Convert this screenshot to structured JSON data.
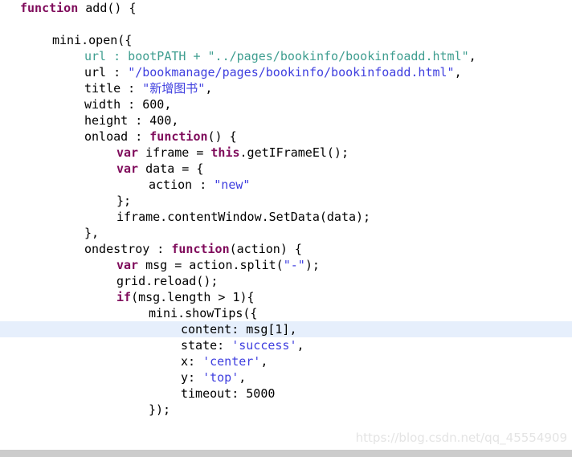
{
  "editor": {
    "language": "javascript",
    "background_color": "#ffffff",
    "highlight_color": "#e6effc",
    "highlighted_line_index": 20,
    "colors": {
      "keyword": "#7f0b5b",
      "string": "#3f3fdf",
      "comment": "#3f9e90",
      "plain": "#000000"
    },
    "lines": [
      {
        "indent": 0,
        "highlighted": false,
        "tokens": [
          {
            "t": "function",
            "c": "kw"
          },
          {
            "t": " add() {",
            "c": "pln"
          }
        ]
      },
      {
        "indent": 0,
        "highlighted": false,
        "tokens": [
          {
            "t": "",
            "c": "pln"
          }
        ]
      },
      {
        "indent": 2,
        "highlighted": false,
        "tokens": [
          {
            "t": "mini.open({",
            "c": "pln"
          }
        ]
      },
      {
        "indent": 4,
        "highlighted": false,
        "tokens": [
          {
            "t": "url : bootPATH + \"../pages/bookinfo/bookinfoadd.html\"",
            "c": "cmt"
          },
          {
            "t": ",",
            "c": "pln"
          }
        ]
      },
      {
        "indent": 4,
        "highlighted": false,
        "tokens": [
          {
            "t": "url : ",
            "c": "pln"
          },
          {
            "t": "\"/bookmanage/pages/bookinfo/bookinfoadd.html\"",
            "c": "str"
          },
          {
            "t": ",",
            "c": "pln"
          }
        ]
      },
      {
        "indent": 4,
        "highlighted": false,
        "tokens": [
          {
            "t": "title : ",
            "c": "pln"
          },
          {
            "t": "\"新增图书\"",
            "c": "str"
          },
          {
            "t": ",",
            "c": "pln"
          }
        ]
      },
      {
        "indent": 4,
        "highlighted": false,
        "tokens": [
          {
            "t": "width : 600,",
            "c": "pln"
          }
        ]
      },
      {
        "indent": 4,
        "highlighted": false,
        "tokens": [
          {
            "t": "height : 400,",
            "c": "pln"
          }
        ]
      },
      {
        "indent": 4,
        "highlighted": false,
        "tokens": [
          {
            "t": "onload : ",
            "c": "pln"
          },
          {
            "t": "function",
            "c": "kw"
          },
          {
            "t": "() {",
            "c": "pln"
          }
        ]
      },
      {
        "indent": 6,
        "highlighted": false,
        "tokens": [
          {
            "t": "var",
            "c": "kw"
          },
          {
            "t": " iframe = ",
            "c": "pln"
          },
          {
            "t": "this",
            "c": "kw"
          },
          {
            "t": ".getIFrameEl();",
            "c": "pln"
          }
        ]
      },
      {
        "indent": 6,
        "highlighted": false,
        "tokens": [
          {
            "t": "var",
            "c": "kw"
          },
          {
            "t": " data = {",
            "c": "pln"
          }
        ]
      },
      {
        "indent": 8,
        "highlighted": false,
        "tokens": [
          {
            "t": "action : ",
            "c": "pln"
          },
          {
            "t": "\"new\"",
            "c": "str"
          }
        ]
      },
      {
        "indent": 6,
        "highlighted": false,
        "tokens": [
          {
            "t": "};",
            "c": "pln"
          }
        ]
      },
      {
        "indent": 6,
        "highlighted": false,
        "tokens": [
          {
            "t": "iframe.contentWindow.SetData(data);",
            "c": "pln"
          }
        ]
      },
      {
        "indent": 4,
        "highlighted": false,
        "tokens": [
          {
            "t": "},",
            "c": "pln"
          }
        ]
      },
      {
        "indent": 4,
        "highlighted": false,
        "tokens": [
          {
            "t": "ondestroy : ",
            "c": "pln"
          },
          {
            "t": "function",
            "c": "kw"
          },
          {
            "t": "(action) {",
            "c": "pln"
          }
        ]
      },
      {
        "indent": 6,
        "highlighted": false,
        "tokens": [
          {
            "t": "var",
            "c": "kw"
          },
          {
            "t": " msg = action.split(",
            "c": "pln"
          },
          {
            "t": "\"-\"",
            "c": "str"
          },
          {
            "t": ");",
            "c": "pln"
          }
        ]
      },
      {
        "indent": 6,
        "highlighted": false,
        "tokens": [
          {
            "t": "grid.reload();",
            "c": "pln"
          }
        ]
      },
      {
        "indent": 6,
        "highlighted": false,
        "tokens": [
          {
            "t": "if",
            "c": "kw"
          },
          {
            "t": "(msg.length > 1){",
            "c": "pln"
          }
        ]
      },
      {
        "indent": 8,
        "highlighted": false,
        "tokens": [
          {
            "t": "mini.showTips({",
            "c": "pln"
          }
        ]
      },
      {
        "indent": 10,
        "highlighted": true,
        "tokens": [
          {
            "t": "content: msg[1],",
            "c": "pln"
          }
        ]
      },
      {
        "indent": 10,
        "highlighted": false,
        "tokens": [
          {
            "t": "state: ",
            "c": "pln"
          },
          {
            "t": "'success'",
            "c": "str"
          },
          {
            "t": ",",
            "c": "pln"
          }
        ]
      },
      {
        "indent": 10,
        "highlighted": false,
        "tokens": [
          {
            "t": "x: ",
            "c": "pln"
          },
          {
            "t": "'center'",
            "c": "str"
          },
          {
            "t": ",",
            "c": "pln"
          }
        ]
      },
      {
        "indent": 10,
        "highlighted": false,
        "tokens": [
          {
            "t": "y: ",
            "c": "pln"
          },
          {
            "t": "'top'",
            "c": "str"
          },
          {
            "t": ",",
            "c": "pln"
          }
        ]
      },
      {
        "indent": 10,
        "highlighted": false,
        "tokens": [
          {
            "t": "timeout: 5000",
            "c": "pln"
          }
        ]
      },
      {
        "indent": 8,
        "highlighted": false,
        "tokens": [
          {
            "t": "});",
            "c": "pln"
          }
        ]
      }
    ]
  },
  "watermark": {
    "text": "https://blog.csdn.net/qq_45554909",
    "color": "#e4e4e4"
  },
  "scrollbar": {
    "orientation": "horizontal",
    "track_color": "#cccccc"
  }
}
